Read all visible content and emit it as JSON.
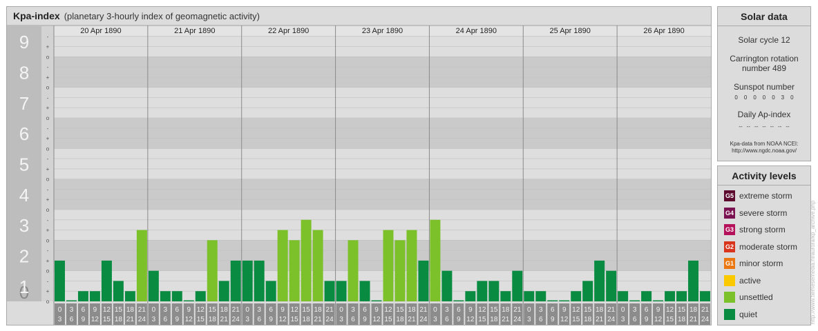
{
  "header": {
    "title": "Kpa-index",
    "subtitle": "(planetary 3-hourly index of geomagnetic activity)"
  },
  "chart_data": {
    "type": "bar",
    "ylim": [
      0,
      9
    ],
    "y_ticks": [
      "0",
      "1",
      "2",
      "3",
      "4",
      "5",
      "6",
      "7",
      "8",
      "9"
    ],
    "minor_ticks": [
      "o",
      "+",
      "-"
    ],
    "days": [
      "20 Apr 1890",
      "21 Apr 1890",
      "22 Apr 1890",
      "23 Apr 1890",
      "24 Apr 1890",
      "25 Apr 1890",
      "26 Apr 1890"
    ],
    "interval_top": [
      "0",
      "3",
      "6",
      "9",
      "12",
      "15",
      "18",
      "21"
    ],
    "interval_bottom": [
      "3",
      "6",
      "9",
      "12",
      "15",
      "18",
      "21",
      "24"
    ],
    "values": [
      1.333,
      0,
      0.333,
      0.333,
      1.333,
      0.667,
      0.333,
      2.333,
      1,
      0.333,
      0.333,
      0,
      0.333,
      2,
      0.667,
      1.333,
      1.333,
      1.333,
      0.667,
      2.333,
      2,
      2.667,
      2.333,
      0.667,
      0.667,
      2,
      0.667,
      0,
      2.333,
      2,
      2.333,
      1.333,
      2.667,
      1,
      0,
      0.333,
      0.667,
      0.667,
      0.333,
      1,
      0.333,
      0.333,
      0,
      0,
      0.333,
      0.667,
      1.333,
      1,
      0.333,
      0,
      0.333,
      0,
      0.333,
      0.333,
      1.333,
      0.333
    ],
    "colors": {
      "quiet": "#098c41",
      "unsettled": "#7cc12a",
      "active": "#fac900"
    }
  },
  "solar": {
    "title": "Solar data",
    "cycle": "Solar cycle 12",
    "carrington_1": "Carrington rotation",
    "carrington_2": "number 489",
    "sunspot_label": "Sunspot number",
    "sunspots": [
      "0",
      "0",
      "0",
      "0",
      "0",
      "3",
      "0"
    ],
    "ap_label": "Daily Ap-index",
    "ap": [
      "--",
      "--",
      "--",
      "--",
      "--",
      "--",
      "--"
    ],
    "source_1": "Kpa-data from NOAA NCEI:",
    "source_2": "http://www.ngdc.noaa.gov/"
  },
  "levels": {
    "title": "Activity levels",
    "items": [
      {
        "code": "G5",
        "label": "extreme storm",
        "color": "#5c0a2e"
      },
      {
        "code": "G4",
        "label": "severe storm",
        "color": "#7a1150"
      },
      {
        "code": "G3",
        "label": "strong storm",
        "color": "#b5105a"
      },
      {
        "code": "G2",
        "label": "moderate storm",
        "color": "#d9341c"
      },
      {
        "code": "G1",
        "label": "minor storm",
        "color": "#ea7712"
      },
      {
        "code": "",
        "label": "active",
        "color": "#fac900"
      },
      {
        "code": "",
        "label": "unsettled",
        "color": "#7cc12a"
      },
      {
        "code": "",
        "label": "quiet",
        "color": "#098c41"
      }
    ]
  },
  "watermark": "http://www.tiemesemedia.nl/aurora/kp_archive.php"
}
